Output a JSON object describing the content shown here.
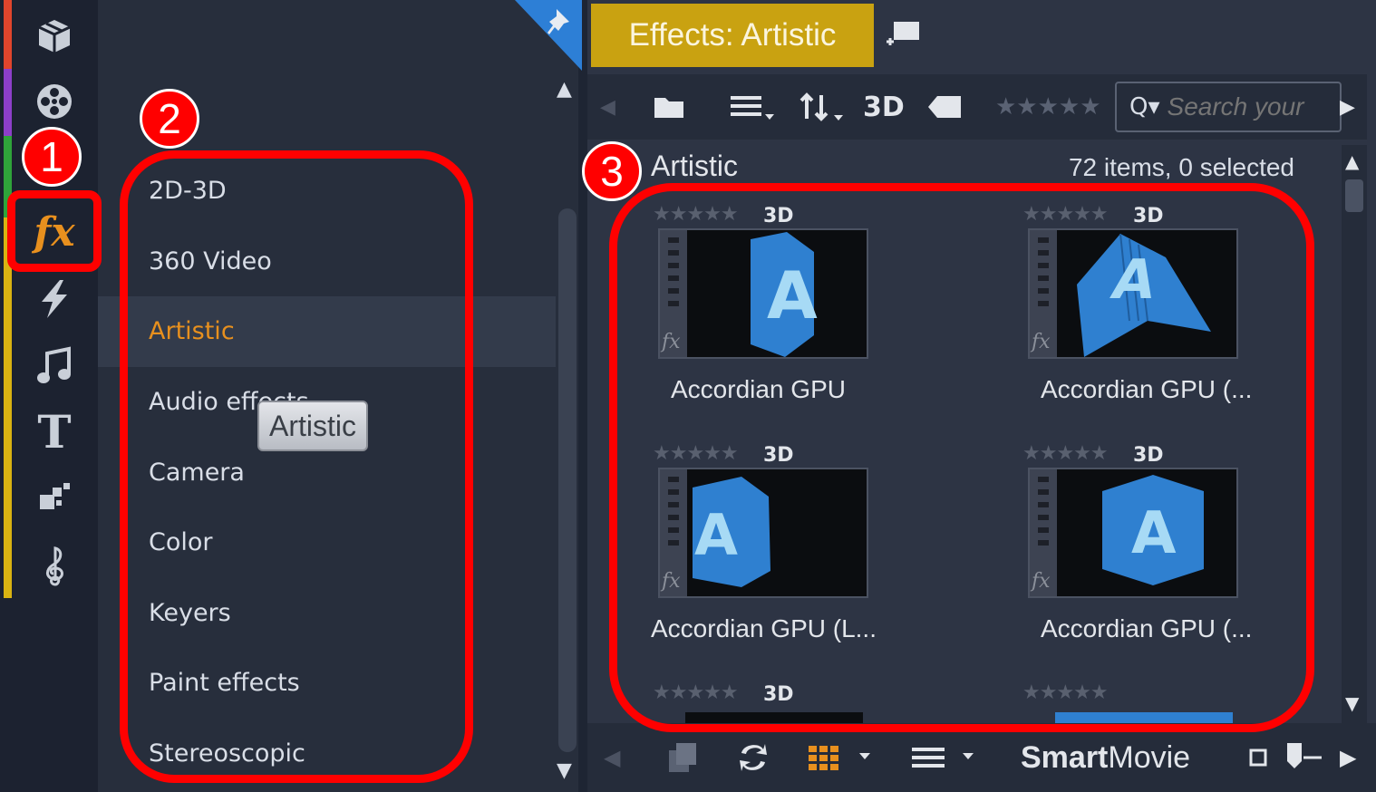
{
  "rail": {
    "icons": [
      "package-icon",
      "film-reel-icon",
      "fx-icon",
      "lightning-icon",
      "music-note-icon",
      "title-icon",
      "transition-icon",
      "treble-clef-icon"
    ],
    "fx_label": "fx",
    "title_label": "T",
    "strip_colors": [
      "#e0452c",
      "#8d3fc9",
      "#2fa43a",
      "#d9b312"
    ]
  },
  "categories": {
    "items": [
      "2D-3D",
      "360 Video",
      "Artistic",
      "Audio effects",
      "Camera",
      "Color",
      "Keyers",
      "Paint effects",
      "Stereoscopic"
    ],
    "active": "Artistic",
    "tooltip": "Artistic"
  },
  "effects": {
    "tab_label": "Effects: Artistic",
    "toolbar": {
      "view_3d": "3D",
      "search_placeholder": "Search your"
    },
    "folder_title": "Artistic",
    "item_count": "72 items, 0 selected",
    "cards": [
      {
        "name": "Accordian GPU",
        "badge": "3D",
        "rating": "★★★★★",
        "glyph": "A"
      },
      {
        "name": "Accordian GPU (...",
        "badge": "3D",
        "rating": "★★★★★",
        "glyph": "A"
      },
      {
        "name": "Accordian GPU (L...",
        "badge": "3D",
        "rating": "★★★★★",
        "glyph": "A"
      },
      {
        "name": "Accordian GPU (...",
        "badge": "3D",
        "rating": "★★★★★",
        "glyph": "A"
      },
      {
        "name": "",
        "badge": "3D",
        "rating": "★★★★★",
        "glyph": ""
      },
      {
        "name": "",
        "badge": "",
        "rating": "★★★★★",
        "glyph": ""
      }
    ],
    "bottom": {
      "smartmovie_bold": "Smart",
      "smartmovie_rest": "Movie"
    }
  },
  "annotations": {
    "labels": [
      "1",
      "2",
      "3"
    ],
    "color": "#ff0000"
  },
  "colors": {
    "accent_orange": "#e8901e",
    "tab_gold": "#c9a211",
    "panel_bg": "#272e3c"
  }
}
